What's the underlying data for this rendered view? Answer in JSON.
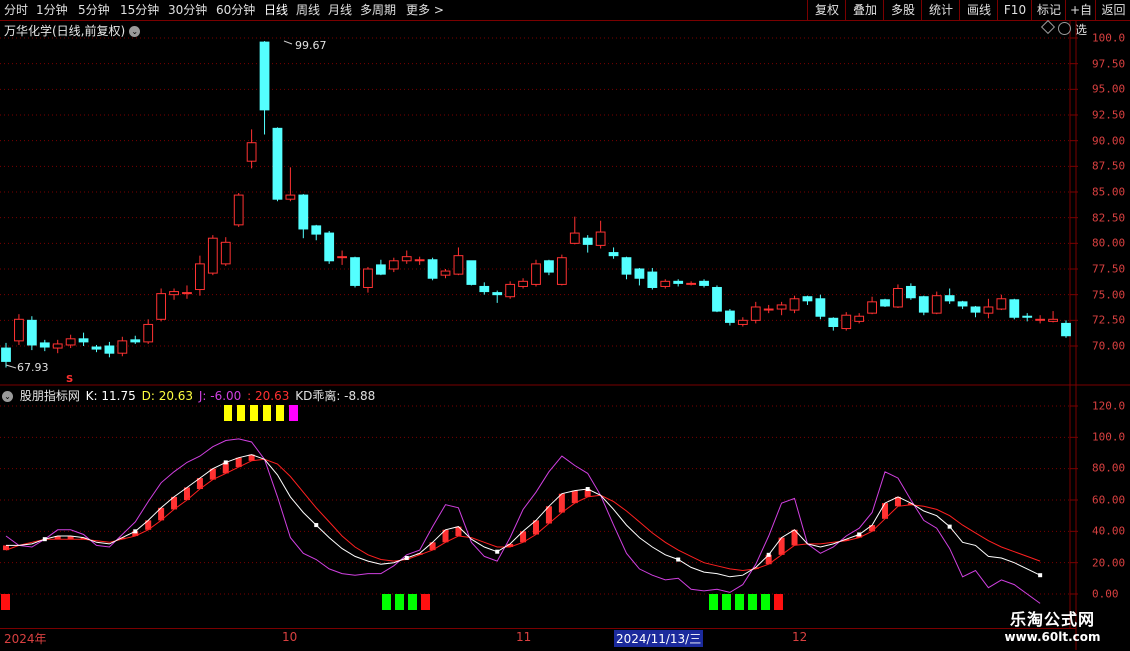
{
  "toolbar": {
    "left": [
      "分时",
      "1分钟",
      "5分钟",
      "15分钟",
      "30分钟",
      "60分钟",
      "日线",
      "周线",
      "月线",
      "多周期",
      "更多 >"
    ],
    "right": [
      "复权",
      "叠加",
      "多股",
      "统计",
      "画线",
      "F10",
      "标记",
      "+自选",
      "返回"
    ]
  },
  "stock_title": "万华化学(日线,前复权)",
  "price_axis": [
    "100.0",
    "97.50",
    "95.00",
    "92.50",
    "90.00",
    "87.50",
    "85.00",
    "82.50",
    "80.00",
    "77.50",
    "75.00",
    "72.50",
    "70.00"
  ],
  "indicator": {
    "name": "股朋指标网",
    "k": "K: 11.75",
    "d": "D: 20.63",
    "j": "J: -6.00",
    "extra": ": 20.63",
    "kd": "KD乖离: -8.88",
    "axis": [
      "120.0",
      "100.0",
      "80.00",
      "60.00",
      "40.00",
      "20.00",
      "0.00"
    ]
  },
  "annotations": {
    "high": "99.67",
    "low": "67.93",
    "s_marker": "S"
  },
  "dates": {
    "year": "2024年",
    "m10": "10",
    "m11": "11",
    "cursor": "2024/11/13/三",
    "m12": "12"
  },
  "watermark": {
    "line1": "乐淘公式网",
    "line2": "www.60lt.com"
  },
  "colors": {
    "up": "#ff3232",
    "down": "#54ffff",
    "grid": "#7a0000",
    "k_line": "#ffffff",
    "d_line": "#ff2020",
    "j_line": "#d040e0"
  },
  "chart_data": {
    "type": "candlestick",
    "candles": [
      [
        69.8,
        68.5,
        70.3,
        67.9
      ],
      [
        70.5,
        72.6,
        73.1,
        70.1
      ],
      [
        72.5,
        70.1,
        72.9,
        69.6
      ],
      [
        70.3,
        69.9,
        70.6,
        69.5
      ],
      [
        69.8,
        70.2,
        70.6,
        69.3
      ],
      [
        70.1,
        70.7,
        71.1,
        69.8
      ],
      [
        70.7,
        70.4,
        71.3,
        70.0
      ],
      [
        69.9,
        69.7,
        70.1,
        69.4
      ],
      [
        70.0,
        69.3,
        70.4,
        68.9
      ],
      [
        69.3,
        70.5,
        70.9,
        69.0
      ],
      [
        70.6,
        70.4,
        71.0,
        70.2
      ],
      [
        70.4,
        72.1,
        72.6,
        70.2
      ],
      [
        72.6,
        75.1,
        75.6,
        72.4
      ],
      [
        75.0,
        75.3,
        75.6,
        74.5
      ],
      [
        75.1,
        75.2,
        75.9,
        74.6
      ],
      [
        75.5,
        78.0,
        78.8,
        74.9
      ],
      [
        77.1,
        80.5,
        80.8,
        76.9
      ],
      [
        78.0,
        80.1,
        80.6,
        77.8
      ],
      [
        81.8,
        84.7,
        84.9,
        81.6
      ],
      [
        88.0,
        89.8,
        91.1,
        87.3
      ],
      [
        99.6,
        93.0,
        99.7,
        90.6
      ],
      [
        91.2,
        84.3,
        91.3,
        84.1
      ],
      [
        84.3,
        84.7,
        87.4,
        84.1
      ],
      [
        84.7,
        81.4,
        84.8,
        80.5
      ],
      [
        81.7,
        80.9,
        81.8,
        80.3
      ],
      [
        81.0,
        78.3,
        81.2,
        78.0
      ],
      [
        78.7,
        78.7,
        79.3,
        77.9
      ],
      [
        78.6,
        75.9,
        78.7,
        75.7
      ],
      [
        75.7,
        77.5,
        77.7,
        75.2
      ],
      [
        77.9,
        77.0,
        78.4,
        76.9
      ],
      [
        77.5,
        78.3,
        78.6,
        77.2
      ],
      [
        78.3,
        78.7,
        79.3,
        78.0
      ],
      [
        78.4,
        78.4,
        78.7,
        77.9
      ],
      [
        78.4,
        76.6,
        78.6,
        76.4
      ],
      [
        76.9,
        77.3,
        77.5,
        76.6
      ],
      [
        77.0,
        78.8,
        79.6,
        76.9
      ],
      [
        78.3,
        76.0,
        78.3,
        75.9
      ],
      [
        75.8,
        75.3,
        76.2,
        75.0
      ],
      [
        75.2,
        75.0,
        75.4,
        74.2
      ],
      [
        74.8,
        76.0,
        76.3,
        74.6
      ],
      [
        75.8,
        76.3,
        76.6,
        75.6
      ],
      [
        76.0,
        78.0,
        78.4,
        75.8
      ],
      [
        78.3,
        77.2,
        78.4,
        76.9
      ],
      [
        76.0,
        78.6,
        78.9,
        75.9
      ],
      [
        80.0,
        81.0,
        82.6,
        79.9
      ],
      [
        80.5,
        79.9,
        80.8,
        79.1
      ],
      [
        79.8,
        81.1,
        82.2,
        79.5
      ],
      [
        79.1,
        78.8,
        79.6,
        78.5
      ],
      [
        78.6,
        77.0,
        78.7,
        76.5
      ],
      [
        77.5,
        76.6,
        77.6,
        75.9
      ],
      [
        77.2,
        75.7,
        77.6,
        75.5
      ],
      [
        75.8,
        76.3,
        76.5,
        75.6
      ],
      [
        76.3,
        76.1,
        76.5,
        75.8
      ],
      [
        76.1,
        76.1,
        76.3,
        75.9
      ],
      [
        76.3,
        75.9,
        76.5,
        75.7
      ],
      [
        75.7,
        73.4,
        75.9,
        73.3
      ],
      [
        73.4,
        72.3,
        73.6,
        72.0
      ],
      [
        72.1,
        72.5,
        72.8,
        71.9
      ],
      [
        72.5,
        73.8,
        74.3,
        72.2
      ],
      [
        73.6,
        73.6,
        74.0,
        73.2
      ],
      [
        73.6,
        74.0,
        74.3,
        73.0
      ],
      [
        73.5,
        74.6,
        74.9,
        73.2
      ],
      [
        74.8,
        74.4,
        74.9,
        74.0
      ],
      [
        74.6,
        72.9,
        75.0,
        72.6
      ],
      [
        72.7,
        71.9,
        72.8,
        71.5
      ],
      [
        71.7,
        73.0,
        73.3,
        71.5
      ],
      [
        72.4,
        72.9,
        73.2,
        72.2
      ],
      [
        73.2,
        74.3,
        74.8,
        73.1
      ],
      [
        74.5,
        73.9,
        74.6,
        73.8
      ],
      [
        73.8,
        75.6,
        76.0,
        73.7
      ],
      [
        75.8,
        74.7,
        76.1,
        74.5
      ],
      [
        74.8,
        73.3,
        74.9,
        73.0
      ],
      [
        73.2,
        74.9,
        75.3,
        73.1
      ],
      [
        74.9,
        74.4,
        75.6,
        74.1
      ],
      [
        74.3,
        73.9,
        74.4,
        73.6
      ],
      [
        73.8,
        73.3,
        73.9,
        72.8
      ],
      [
        73.2,
        73.8,
        74.6,
        72.7
      ],
      [
        73.6,
        74.6,
        75.0,
        73.5
      ],
      [
        74.5,
        72.8,
        74.6,
        72.6
      ],
      [
        72.9,
        72.8,
        73.2,
        72.4
      ],
      [
        72.6,
        72.6,
        73.0,
        72.2
      ],
      [
        72.4,
        72.6,
        73.4,
        72.3
      ],
      [
        72.2,
        71.0,
        72.5,
        70.8
      ]
    ],
    "k": [
      31,
      31,
      32,
      35,
      37,
      37,
      36,
      33,
      32,
      36,
      40,
      47,
      55,
      62,
      68,
      74,
      80,
      84,
      87,
      89,
      86,
      76,
      62,
      52,
      44,
      36,
      29,
      24,
      21,
      19,
      20,
      23,
      26,
      33,
      41,
      43,
      35,
      30,
      27,
      32,
      40,
      47,
      56,
      64,
      66,
      67,
      63,
      54,
      44,
      36,
      30,
      25,
      22,
      17,
      14,
      13,
      11,
      12,
      17,
      25,
      36,
      41,
      32,
      30,
      32,
      35,
      38,
      44,
      58,
      62,
      58,
      53,
      50,
      43,
      33,
      31,
      24,
      23,
      20,
      16,
      12
    ],
    "d": [
      28,
      31,
      33,
      35,
      35,
      35,
      35,
      34,
      33,
      35,
      37,
      41,
      47,
      54,
      60,
      67,
      73,
      77,
      81,
      85,
      86,
      83,
      75,
      65,
      55,
      46,
      37,
      30,
      25,
      22,
      21,
      22,
      25,
      28,
      33,
      37,
      36,
      33,
      30,
      30,
      33,
      38,
      45,
      52,
      58,
      62,
      63,
      59,
      53,
      46,
      39,
      33,
      28,
      24,
      20,
      18,
      16,
      15,
      16,
      19,
      25,
      31,
      32,
      32,
      33,
      34,
      36,
      40,
      48,
      56,
      57,
      56,
      54,
      50,
      44,
      39,
      34,
      30,
      27,
      24,
      21
    ]
  }
}
